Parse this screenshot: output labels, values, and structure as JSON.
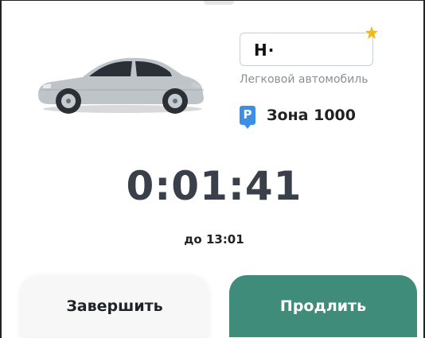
{
  "vehicle": {
    "plate": "Н·",
    "type": "Легковой автомобиль",
    "plate_favorite_color": "#f5b916",
    "car_image": "silver-sedan"
  },
  "zone": {
    "badge": "P",
    "label": "Зона 1000",
    "badge_color": "#3c8ee6"
  },
  "session": {
    "timer": "0:01:41",
    "until": "до 13:01"
  },
  "actions": {
    "finish_label": "Завершить",
    "extend_label": "Продлить",
    "extend_color": "#3e8c79"
  }
}
